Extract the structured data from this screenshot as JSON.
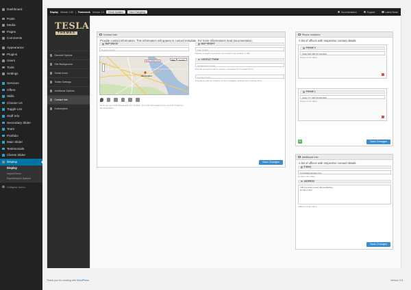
{
  "wp_menu": {
    "items": [
      {
        "label": "Dashboard",
        "name": "wp-menu-dashboard",
        "cp": false
      },
      {
        "sep": true
      },
      {
        "label": "Posts",
        "name": "wp-menu-posts",
        "cp": false
      },
      {
        "label": "Media",
        "name": "wp-menu-media",
        "cp": false
      },
      {
        "label": "Pages",
        "name": "wp-menu-pages",
        "cp": false
      },
      {
        "label": "Comments",
        "name": "wp-menu-comments",
        "cp": false
      },
      {
        "sep": true
      },
      {
        "label": "Appearance",
        "name": "wp-menu-appearance",
        "cp": false
      },
      {
        "label": "Plugins",
        "name": "wp-menu-plugins",
        "cp": false
      },
      {
        "label": "Users",
        "name": "wp-menu-users",
        "cp": false
      },
      {
        "label": "Tools",
        "name": "wp-menu-tools",
        "cp": false
      },
      {
        "label": "Settings",
        "name": "wp-menu-settings",
        "cp": false
      },
      {
        "sep": true
      },
      {
        "label": "Services",
        "name": "wp-menu-services",
        "cp": true
      },
      {
        "label": "Offers",
        "name": "wp-menu-offers",
        "cp": true
      },
      {
        "label": "Skills",
        "name": "wp-menu-skills",
        "cp": true
      },
      {
        "label": "Choose Us",
        "name": "wp-menu-choose-us",
        "cp": true
      },
      {
        "label": "Toggle List",
        "name": "wp-menu-toggle-list",
        "cp": true
      },
      {
        "label": "Staff Info",
        "name": "wp-menu-staff-info",
        "cp": true
      },
      {
        "label": "Secondary Slider",
        "name": "wp-menu-secondary-slider",
        "cp": true
      },
      {
        "label": "Team",
        "name": "wp-menu-team",
        "cp": true
      },
      {
        "label": "Portfolio",
        "name": "wp-menu-portfolio",
        "cp": true
      },
      {
        "label": "Main Slider",
        "name": "wp-menu-main-slider",
        "cp": true
      },
      {
        "label": "Testimonials",
        "name": "wp-menu-testimonials",
        "cp": true
      },
      {
        "label": "Clients Slider",
        "name": "wp-menu-clients-slider",
        "cp": true
      },
      {
        "label": "Display",
        "name": "wp-menu-display",
        "cp": false,
        "active": true
      }
    ],
    "submenu": [
      "Display",
      "Import Demo",
      "Export/Import Options"
    ],
    "collapse": "Collapse menu"
  },
  "topbar": {
    "title": "Display",
    "version": "Version 1.00",
    "framework": "Framework",
    "framework_version": "Version 1.0",
    "check_updates": "Check Updates",
    "view_changelog": "View Changelog",
    "documentation": "Documentation",
    "support": "Support",
    "latest_news": "Latest News"
  },
  "logo": {
    "main": "TESLA",
    "sub": "THEMES"
  },
  "side_nav": [
    {
      "label": "General Options",
      "name": "nav-general-options"
    },
    {
      "label": "Site Background",
      "name": "nav-site-background"
    },
    {
      "label": "Social Icons",
      "name": "nav-social-icons"
    },
    {
      "label": "Twitter Settings",
      "name": "nav-twitter-settings"
    },
    {
      "label": "Additional Options",
      "name": "nav-additional-options"
    },
    {
      "label": "Contact Info",
      "name": "nav-contact-info",
      "selected": true
    },
    {
      "label": "Subscription",
      "name": "nav-subscription"
    }
  ],
  "contact_panel": {
    "title": "Contact Info",
    "intro": "Provide contact information. This information will appear in contact template. For more informations read documentation.",
    "map_image_label": "MAP IMAGE",
    "map_image_placeholder": "Select location",
    "map_height_label": "MAP HEIGHT",
    "map_height_placeholder": "Map Height",
    "map_height_hint": "Specify a height in pixels for the contact map (default is 700)",
    "contact_form_label": "CONTACT FORM",
    "contact_email_placeholder": "Contact form email",
    "contact_email_hint": "Provide personal email to receive messages from Contact Form",
    "contact_prefix_placeholder": "Contact Prefix",
    "contact_prefix_hint": "Provide a prefix for subjects of the messages received from Contact Form",
    "map_hint": "Here you can insert iframe with your location. For more informations you can find in theme's documentation.",
    "map_type": {
      "map": "Map",
      "satellite": "Satellite"
    },
    "map_info": "Drop marker here",
    "map_city": "Washington",
    "save": "Save Changes"
  },
  "phone_panel": {
    "title": "Phone numbers",
    "intro": "A list of offices with respective contact details.",
    "phones": [
      {
        "label": "PHONE 0",
        "value": "(040) 055 055 55 789 889",
        "hint": "Phone of the office"
      },
      {
        "label": "PHONE 1",
        "value": "(044) 777 454 55 555 888",
        "hint": "Phone of the office"
      }
    ],
    "add": "+",
    "save": "Save Changes"
  },
  "additional_panel": {
    "title": "Additional Info",
    "intro": "A list of offices with respective contact details.",
    "email_label": "E-MAIL",
    "email_value": "contact@example.com",
    "email_hint": "E-mail of the office",
    "address_label": "ADDRESS",
    "address_value": "128 revolution road, Street Monkey\nNY-81,2 off 2",
    "address_hint": "Address of the office",
    "save": "Save Changes"
  },
  "footer": {
    "text": "Thank you for creating with ",
    "link": "WordPress",
    "version": "Version 3.8"
  }
}
